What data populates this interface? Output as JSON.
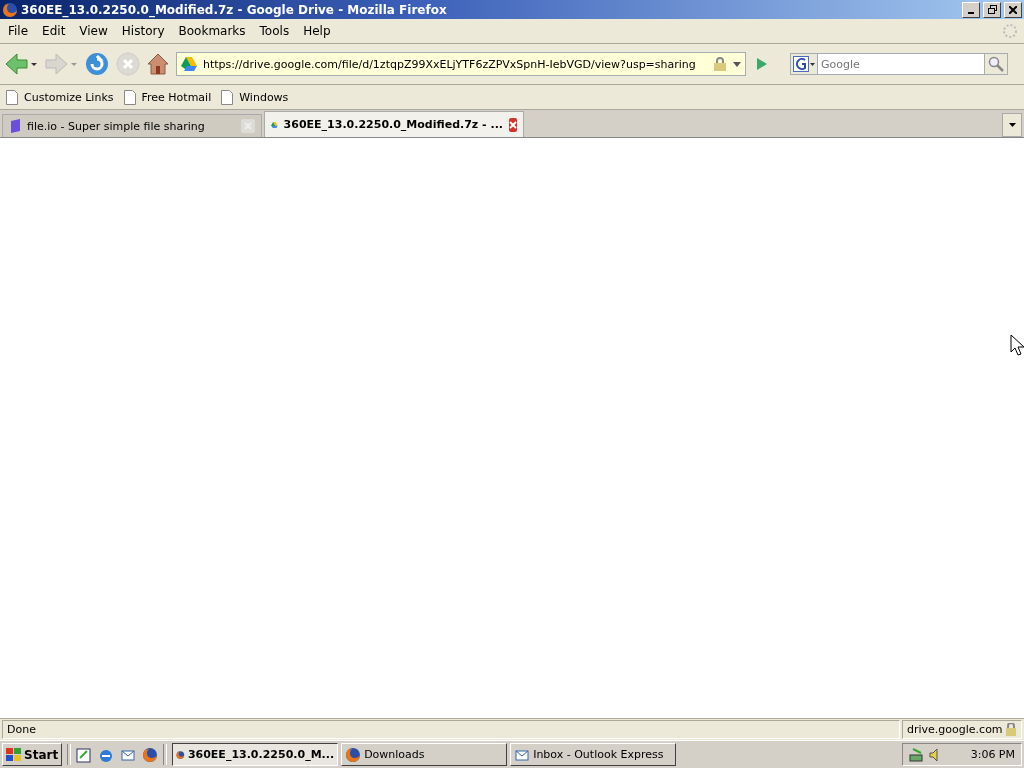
{
  "window": {
    "title": "360EE_13.0.2250.0_Modified.7z - Google Drive - Mozilla Firefox"
  },
  "menu": [
    "File",
    "Edit",
    "View",
    "History",
    "Bookmarks",
    "Tools",
    "Help"
  ],
  "toolbar": {
    "url": "https://drive.google.com/file/d/1ztqpZ99XxELjYTF6zZPVxSpnH-IebVGD/view?usp=sharing",
    "search_placeholder": "Google"
  },
  "bookmarks": [
    "Customize Links",
    "Free Hotmail",
    "Windows"
  ],
  "tabs": [
    {
      "label": "file.io - Super simple file sharing",
      "selected": false,
      "kind": "fileio"
    },
    {
      "label": "360EE_13.0.2250.0_Modified.7z - ...",
      "selected": true,
      "kind": "drive"
    }
  ],
  "status_bar": {
    "text": "Done",
    "domain": "drive.google.com"
  },
  "taskbar": {
    "start": "Start",
    "buttons": [
      {
        "label": "360EE_13.0.2250.0_M...",
        "selected": true,
        "kind": "firefox"
      },
      {
        "label": "Downloads",
        "selected": false,
        "kind": "firefox"
      },
      {
        "label": "Inbox - Outlook Express",
        "selected": false,
        "kind": "outlook"
      }
    ],
    "clock": "3:06 PM"
  }
}
